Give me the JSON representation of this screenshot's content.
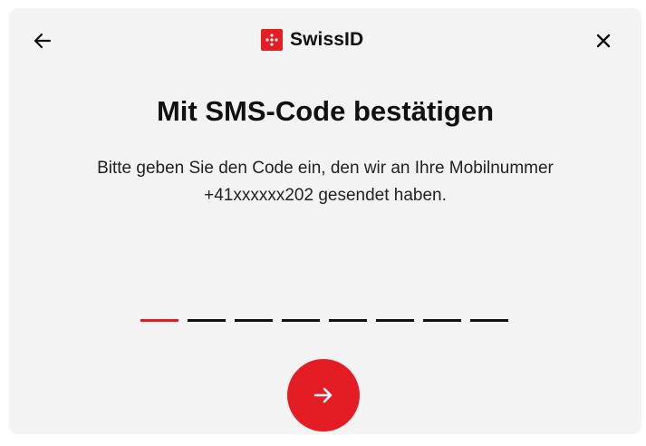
{
  "header": {
    "brand_name": "SwissID",
    "back_icon": "arrow-left-icon",
    "close_icon": "close-icon",
    "brand_logo_icon": "swissid-logo-icon",
    "brand_color": "#e41c24"
  },
  "main": {
    "title": "Mit SMS-Code bestätigen",
    "description_line1": "Bitte geben Sie den Code ein, den wir an Ihre Mobilnummer",
    "description_line2": "+41xxxxxx202 gesendet haben."
  },
  "code_input": {
    "length": 8,
    "value": "",
    "active_index": 0,
    "active_color": "#e41c24",
    "inactive_color": "#111111"
  },
  "submit": {
    "icon": "arrow-right-icon"
  }
}
